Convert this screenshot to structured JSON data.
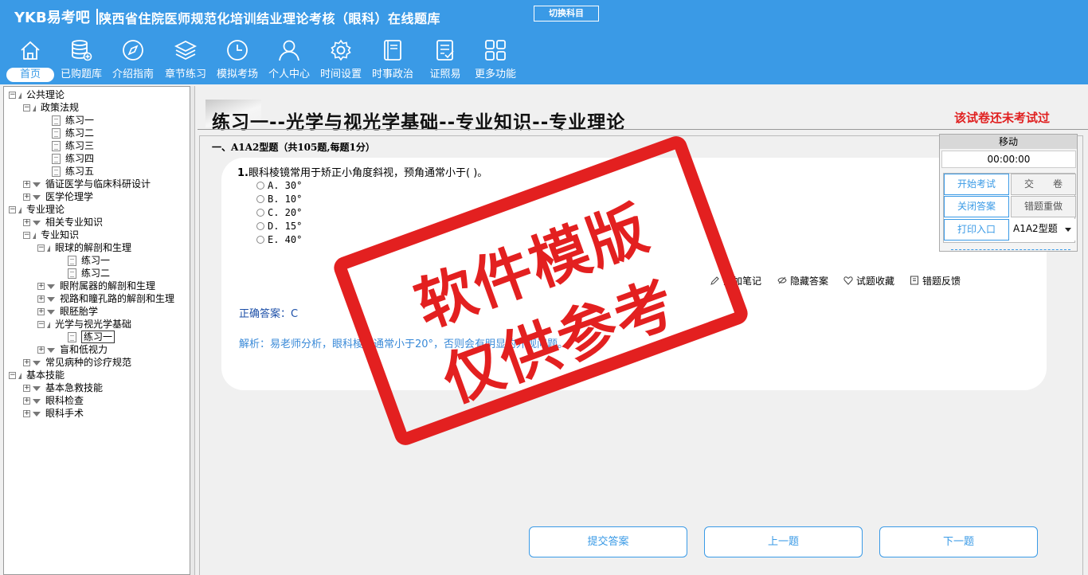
{
  "header": {
    "logo": "YKB易考吧",
    "site_title": "陕西省住院医师规范化培训结业理论考核（眼科）在线题库",
    "switch_subject": "切换科目"
  },
  "nav": [
    {
      "label": "首页",
      "icon": "home-icon"
    },
    {
      "label": "已购题库",
      "icon": "database-icon"
    },
    {
      "label": "介绍指南",
      "icon": "compass-icon"
    },
    {
      "label": "章节练习",
      "icon": "layers-icon"
    },
    {
      "label": "模拟考场",
      "icon": "clock-icon"
    },
    {
      "label": "个人中心",
      "icon": "user-icon"
    },
    {
      "label": "时间设置",
      "icon": "gear-icon"
    },
    {
      "label": "时事政治",
      "icon": "book-icon"
    },
    {
      "label": "证照易",
      "icon": "checklist-icon"
    },
    {
      "label": "更多功能",
      "icon": "grid-icon"
    }
  ],
  "tree": [
    {
      "label": "公共理论"
    },
    {
      "label": "政策法规"
    },
    {
      "label": "练习一"
    },
    {
      "label": "练习二"
    },
    {
      "label": "练习三"
    },
    {
      "label": "练习四"
    },
    {
      "label": "练习五"
    },
    {
      "label": "循证医学与临床科研设计"
    },
    {
      "label": "医学伦理学"
    },
    {
      "label": "专业理论"
    },
    {
      "label": "相关专业知识"
    },
    {
      "label": "专业知识"
    },
    {
      "label": "眼球的解剖和生理"
    },
    {
      "label": "练习一"
    },
    {
      "label": "练习二"
    },
    {
      "label": "眼附属器的解剖和生理"
    },
    {
      "label": "视路和瞳孔路的解剖和生理"
    },
    {
      "label": "眼胚胎学"
    },
    {
      "label": "光学与视光学基础"
    },
    {
      "label": "练习一"
    },
    {
      "label": "盲和低视力"
    },
    {
      "label": "常见病种的诊疗规范"
    },
    {
      "label": "基本技能"
    },
    {
      "label": "基本急救技能"
    },
    {
      "label": "眼科检查"
    },
    {
      "label": "眼科手术"
    }
  ],
  "exam": {
    "title": "练习一--光学与视光学基础--专业知识--专业理论",
    "status": "该试卷还未考试过",
    "section": "一、A1A2型题（共105题,每题1分）"
  },
  "question": {
    "number": "1.",
    "stem": "眼科棱镜常用于矫正小角度斜视，预角通常小于( )。",
    "options": [
      "A. 30°",
      "B. 10°",
      "C. 20°",
      "D. 15°",
      "E. 40°"
    ],
    "actions": {
      "add_note": "添加笔记",
      "hide_answer": "隐藏答案",
      "favorite": "试题收藏",
      "feedback": "错题反馈"
    },
    "correct_answer": "正确答案：C",
    "analysis": "解析：易老师分析，眼科棱镜通常小于20°，否则会有明显的外观问题。"
  },
  "bottom_buttons": {
    "submit": "提交答案",
    "prev": "上一题",
    "next": "下一题"
  },
  "control_panel": {
    "move": "移动",
    "timer": "00:00:00",
    "start_exam": "开始考试",
    "submit_paper": "交　　卷",
    "close_answer": "关闭答案",
    "redo_wrong": "错题重做",
    "print": "打印入口",
    "question_type": "A1A2型题"
  },
  "watermark": {
    "line1": "软件模版",
    "line2": "仅供参考"
  },
  "colors": {
    "header_bg": "#3a9ae6",
    "stamp": "#e32020",
    "status_red": "#e02020",
    "answer_blue": "#1c4fa8"
  }
}
